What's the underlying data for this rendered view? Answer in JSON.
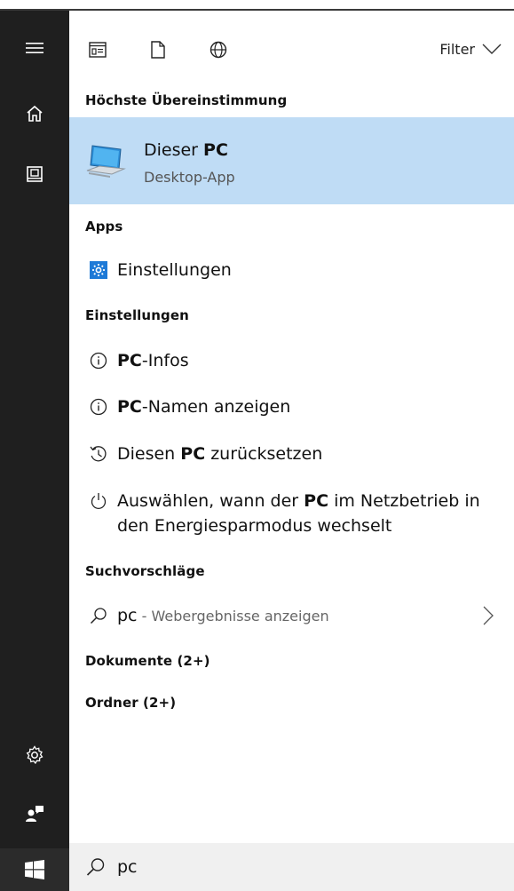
{
  "toolbar": {
    "icons": [
      "apps-icon",
      "document-icon",
      "web-icon"
    ],
    "filter_label": "Filter"
  },
  "sections": {
    "best_match": "Höchste Übereinstimmung",
    "apps": "Apps",
    "settings": "Einstellungen",
    "suggestions": "Suchvorschläge",
    "documents": "Dokumente (2+)",
    "folders": "Ordner (2+)"
  },
  "best_match": {
    "title_prefix": "Dieser ",
    "title_keyword": "PC",
    "subtitle": "Desktop-App"
  },
  "apps": [
    {
      "label": "Einstellungen"
    }
  ],
  "settings_items": [
    {
      "keyword": "PC",
      "rest": "-Infos"
    },
    {
      "keyword": "PC",
      "rest": "-Namen anzeigen"
    },
    {
      "prefix": "Diesen ",
      "keyword": "PC",
      "rest": " zurücksetzen"
    },
    {
      "prefix": "Auswählen, wann der ",
      "keyword": "PC",
      "rest": " im Netzbetrieb in",
      "line2": "den Energiesparmodus wechselt"
    }
  ],
  "suggestion": {
    "term": "pc",
    "sub": " - Webergebnisse anzeigen"
  },
  "search": {
    "value": "pc"
  },
  "colors": {
    "rail": "#1f1f1f",
    "highlight": "#bfdcf5",
    "search_bg": "#f0f0f0",
    "settings_icon": "#1e7ad7"
  }
}
